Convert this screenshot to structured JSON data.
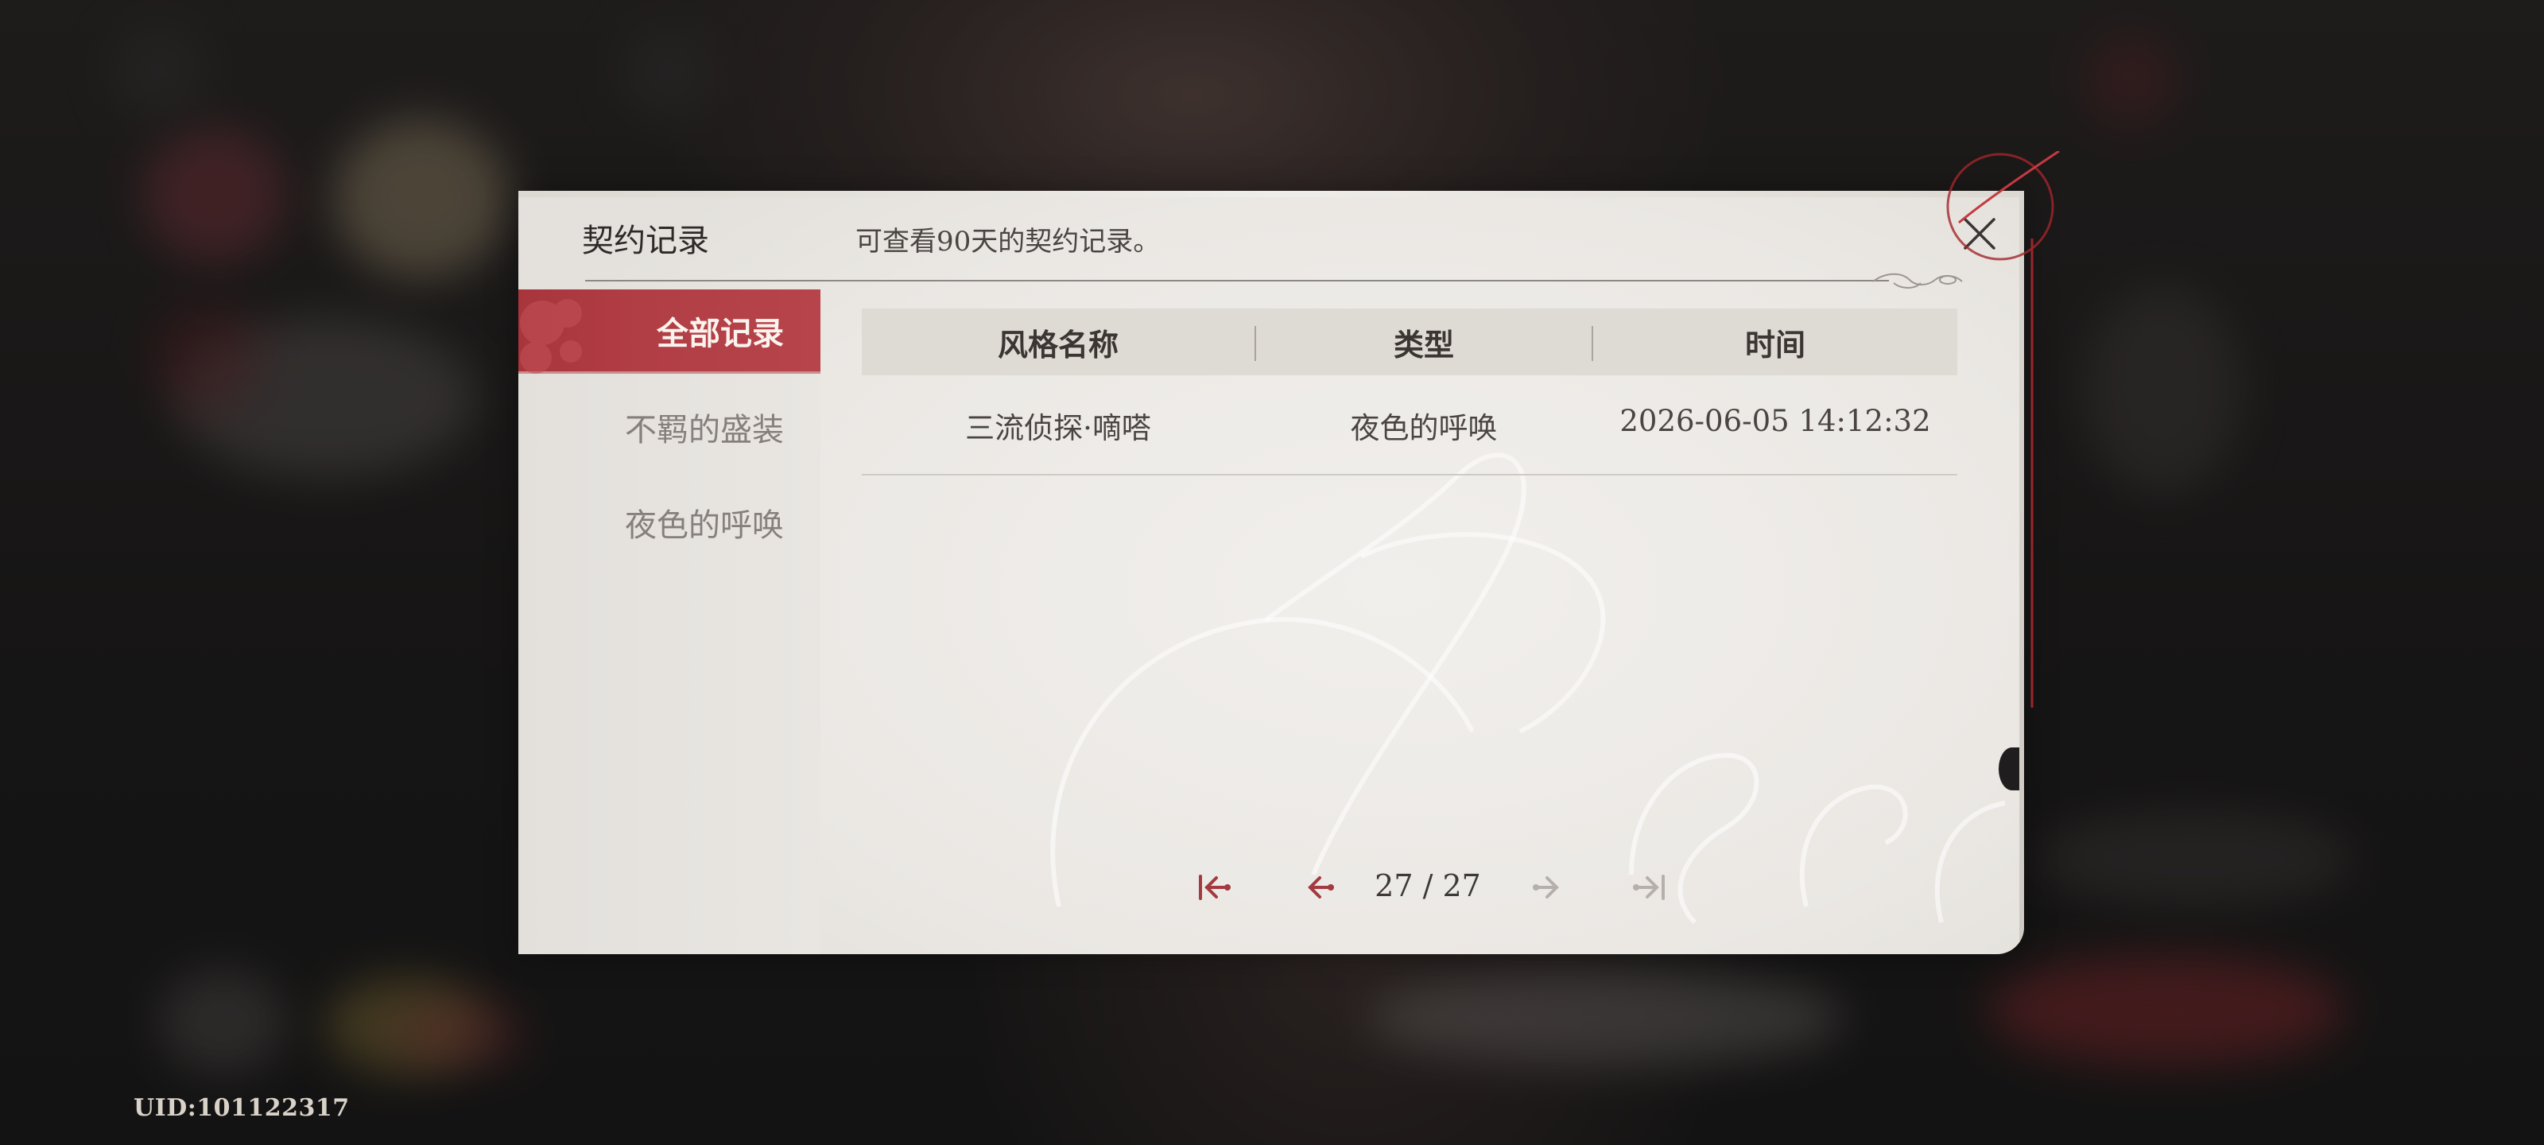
{
  "uid_label": "UID:101122317",
  "dialog": {
    "title": "契约记录",
    "subtitle": "可查看90天的契约记录。",
    "close_icon": "close-icon"
  },
  "sidebar": {
    "items": [
      {
        "label": "全部记录",
        "active": true
      },
      {
        "label": "不羁的盛装",
        "active": false
      },
      {
        "label": "夜色的呼唤",
        "active": false
      }
    ]
  },
  "table": {
    "columns": [
      "风格名称",
      "类型",
      "时间"
    ],
    "rows": [
      {
        "name": "三流侦探·嘀嗒",
        "type": "夜色的呼唤",
        "time": "2026-06-05 14:12:32"
      }
    ]
  },
  "pagination": {
    "current": 27,
    "total": 27,
    "display": "27 / 27",
    "icons": [
      "first-page-icon",
      "prev-page-icon",
      "next-page-icon",
      "last-page-icon"
    ]
  },
  "colors": {
    "accent": "#b13e44",
    "paper": "#ebe8e4",
    "disabled": "#b5b0ab"
  }
}
